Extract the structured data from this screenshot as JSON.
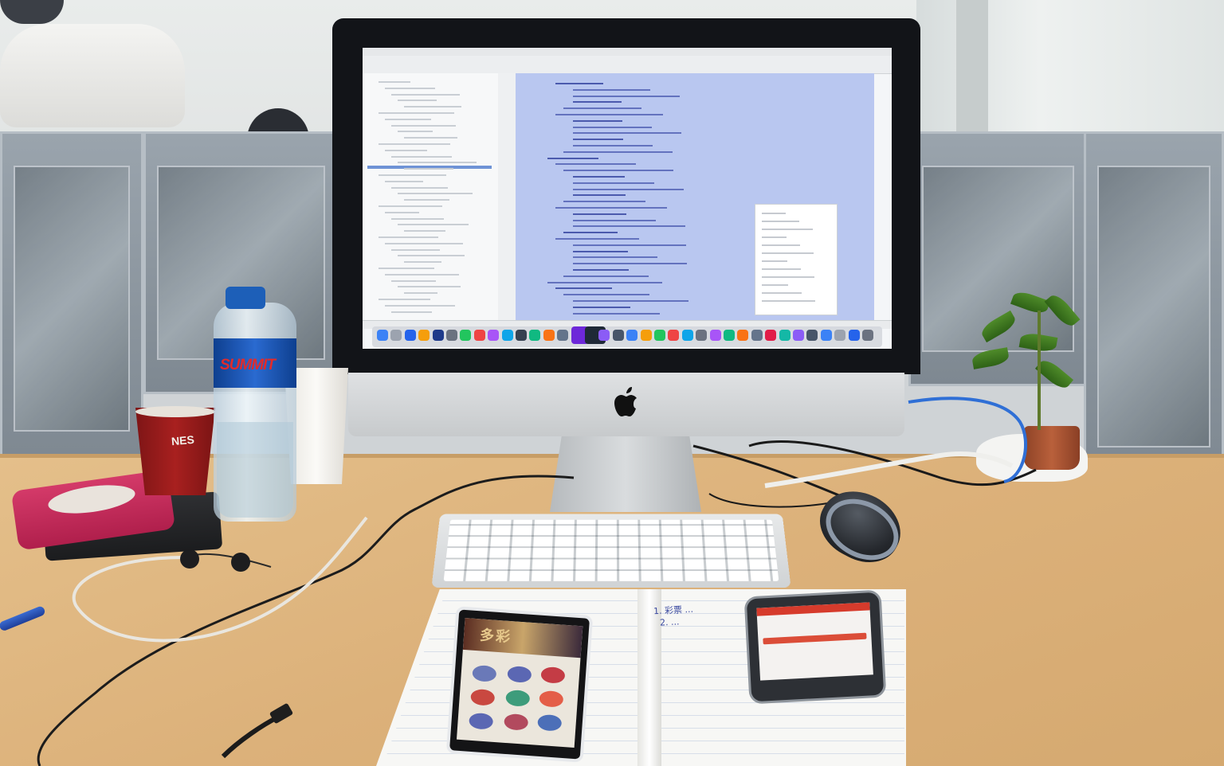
{
  "scene": {
    "description_tag": "desk-workspace-photo"
  },
  "monitor": {
    "brand_icon": "apple-logo-icon",
    "brand_glyph": ""
  },
  "screen": {
    "dock_icons": [
      "finder-icon",
      "launchpad-icon",
      "safari-icon",
      "chrome-icon",
      "photoshop-icon",
      "android-studio-icon",
      "terminal-icon",
      "settings-icon",
      "trash-icon"
    ]
  },
  "desk_items": {
    "bottle_brand": "SUMMIT",
    "cup_brand": "NES",
    "handwriting_line1": "1. 彩票 ...",
    "handwriting_line2": "2. ...",
    "android_app_title": "多彩"
  },
  "colors": {
    "desk": "#dcb17a",
    "editor_highlight": "#b9c7f0",
    "bottle_cap": "#1d5fb8",
    "wallet": "#c42b5a"
  }
}
